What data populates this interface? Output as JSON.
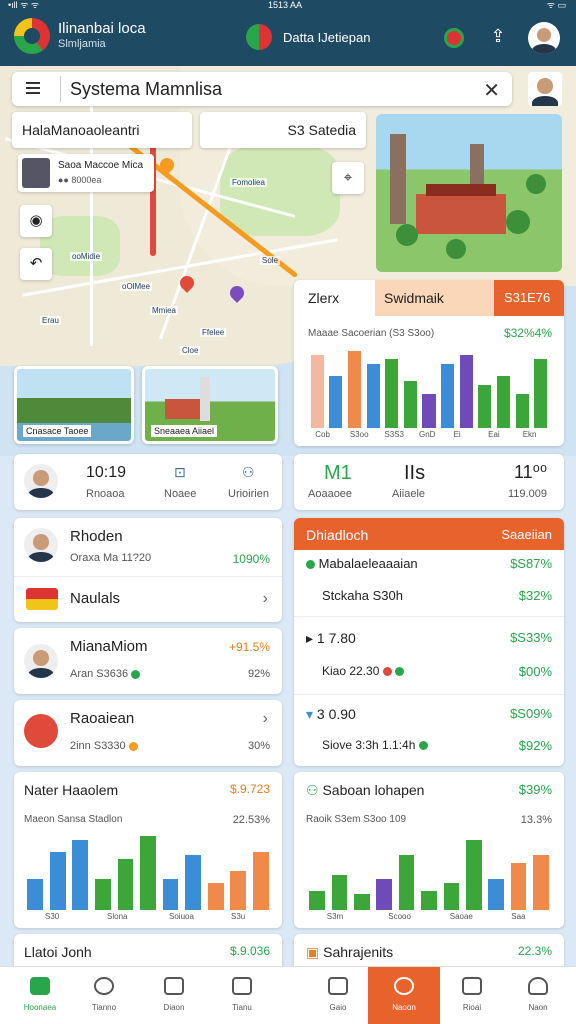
{
  "status": {
    "time": "1513 AA",
    "left": "•ıll ᯤ ᯤ",
    "right": "ᯤ ▭"
  },
  "app": {
    "title": "Ilinanbai loca",
    "subtitle": "Slmljamia",
    "center_label": "Datta IJetiepan"
  },
  "search": {
    "value": "Systema Mamnlisa"
  },
  "chips": {
    "left": "HalaManoaoleantri",
    "right": "S3 Satedia"
  },
  "place": {
    "title": "Saoa Maccoe Mica",
    "sub": "●● 8000ea"
  },
  "map_labels": [
    "Fomoliea",
    "ooMidie",
    "oOlMee",
    "Mmiea",
    "Ffelee",
    "Sole",
    "Erau",
    "Cloe"
  ],
  "photos": {
    "left_caption": "Cnasace Taoee",
    "right_caption": "Sneaaea Aiiael"
  },
  "chart1": {
    "tab_a": "Zlerx",
    "tab_b": "Swidmaik",
    "tab_value": "S31E76",
    "sub_left": "Maaae Sacoerian (S3 S3oo)",
    "sub_right": "$32%4%",
    "x_labels": [
      "Cob",
      "S3oo",
      "S3S3",
      "GnD",
      "Ei",
      "Eai",
      "Ekn"
    ],
    "values": [
      85,
      60,
      90,
      75,
      80,
      55,
      40,
      75,
      85,
      50,
      60,
      40,
      80
    ],
    "colors": [
      "#f2b9a0",
      "#3b8ed6",
      "#f08a4b",
      "#3b8ed6",
      "#3ca63a",
      "#3ca63a",
      "#6e4bb8",
      "#3b8ed6",
      "#6e4bb8",
      "#3ca63a",
      "#3ca63a",
      "#3ca63a",
      "#3ca63a"
    ]
  },
  "profile_row": {
    "value": "10:19",
    "label": "Rnoaoa",
    "mid_label": "Noaee",
    "right_label": "Urioirien"
  },
  "stats_row": {
    "a_value": "M1",
    "a_label": "Aoaaoee",
    "b_value": "IIs",
    "b_label": "Aiiaele",
    "c_value": "11⁰⁰",
    "c_label": "119.009"
  },
  "list_left": [
    {
      "title": "Rhoden",
      "sub": "Oraxa Ma 11?20",
      "value": "1090%"
    },
    {
      "title": "Naulals",
      "sub": "",
      "value": ""
    },
    {
      "title": "MianaMiom",
      "sub": "Aran S3636",
      "value": "+91.5%",
      "value2": "92%"
    },
    {
      "title": "Raoaiean",
      "sub": "2inn S3330",
      "value": "",
      "value2": "30%"
    }
  ],
  "panel_right": {
    "header": "Dhiadloch",
    "header_right": "Saaeiian",
    "rows": [
      {
        "title": "Mabalaeleaaaian",
        "value": "$S87%"
      },
      {
        "title": "Stckaha S30h",
        "value": "$32%"
      },
      {
        "title": "1 7.80",
        "value": "$S33%"
      },
      {
        "title": "Kiao 22.30",
        "value": "$00%"
      },
      {
        "title": "3 0.90",
        "value": "$S09%"
      },
      {
        "title": "Siove 3:3h 1.1:4h",
        "value": "$92%"
      }
    ]
  },
  "chart2": {
    "title": "Nater Haaolem",
    "value": "$.9.723",
    "sub_left": "Maeon Sansa Stadlon",
    "sub_right": "22.53%",
    "x_labels": [
      "S30",
      "Slona",
      "Soiuoa",
      "S3u"
    ],
    "values": [
      40,
      75,
      90,
      40,
      65,
      95,
      40,
      70,
      35,
      50,
      75
    ],
    "colors": [
      "#3b8ed6",
      "#3b8ed6",
      "#3b8ed6",
      "#3ca63a",
      "#3ca63a",
      "#3ca63a",
      "#3b8ed6",
      "#3b8ed6",
      "#f08a4b",
      "#f08a4b",
      "#f08a4b"
    ]
  },
  "chart3": {
    "title": "Saboan lohapen",
    "value": "$39%",
    "sub_left": "Raoik S3em S3oo 109",
    "sub_right": "13.3%",
    "x_labels": [
      "S3m",
      "Scooo",
      "Saoae",
      "Saa"
    ],
    "values": [
      25,
      45,
      20,
      40,
      70,
      25,
      35,
      90,
      40,
      60,
      70
    ],
    "colors": [
      "#3ca63a",
      "#3ca63a",
      "#3ca63a",
      "#6e4bb8",
      "#3ca63a",
      "#3ca63a",
      "#3ca63a",
      "#3ca63a",
      "#3b8ed6",
      "#f08a4b",
      "#f08a4b"
    ]
  },
  "footer_left": {
    "title": "Llatoi Jonh",
    "value": "$.9.036"
  },
  "footer_right": {
    "title": "Sahrajenits",
    "value": "22.3%"
  },
  "nav": [
    "Hoonaea",
    "Tianno",
    "Diaon",
    "Tianu",
    "Gaio",
    "Naoon",
    "Rioai",
    "Naon"
  ],
  "accent": "#e8632c",
  "brand": "#1f4a63"
}
